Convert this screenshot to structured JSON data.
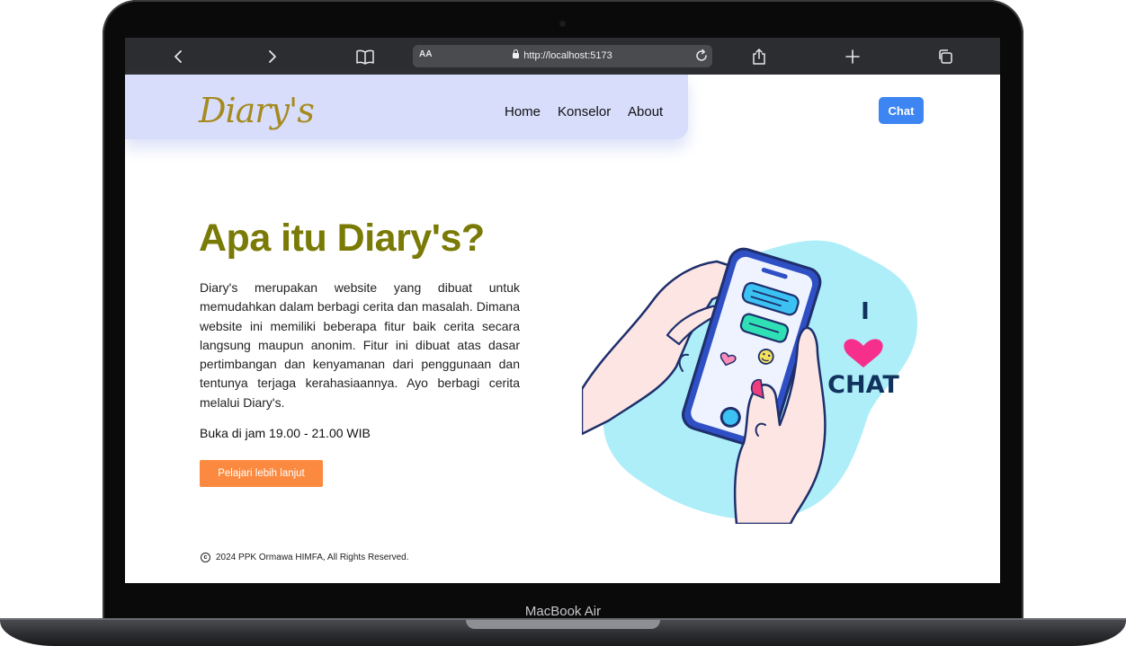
{
  "device": {
    "label": "MacBook Air"
  },
  "browser": {
    "aa_label": "AA",
    "url": "http://localhost:5173",
    "icons": [
      "back-icon",
      "forward-icon",
      "bookmarks-icon",
      "lock-icon",
      "reload-icon",
      "share-icon",
      "new-tab-icon",
      "tabs-icon"
    ]
  },
  "site": {
    "logo": "Diary's",
    "nav": {
      "home": "Home",
      "konselor": "Konselor",
      "about": "About"
    },
    "chat_button": "Chat"
  },
  "hero": {
    "title": "Apa itu Diary's?",
    "description": "Diary's merupakan website yang dibuat untuk memudahkan dalam berbagi cerita dan masalah. Dimana website ini memiliki beberapa fitur baik cerita secara langsung maupun anonim. Fitur ini dibuat atas dasar pertimbangan dan kenyamanan dari penggunaan dan tentunya terjaga kerahasiaannya. Ayo berbagi cerita melalui Diary's.",
    "hours": "Buka di jam 19.00 - 21.00 WIB",
    "cta": "Pelajari lebih lanjut"
  },
  "illustration": {
    "i_text": "I",
    "chat_text": "CHAT"
  },
  "footer": {
    "copyright": "2024 PPK Ormawa HIMFA, All Rights Reserved."
  },
  "colors": {
    "nav_bg": "#d8ddfb",
    "accent_blue": "#3d85f2",
    "title_olive": "#7a7a06",
    "cta_orange": "#fb8a40",
    "logo_gold": "#a58a1e"
  }
}
